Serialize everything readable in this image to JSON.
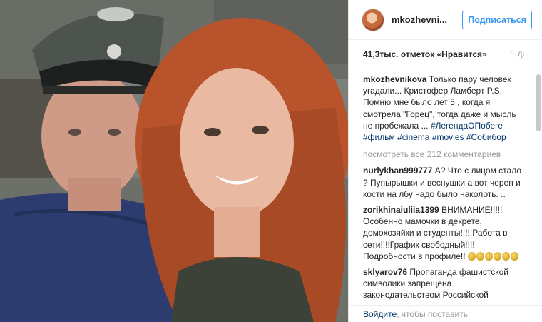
{
  "header": {
    "username": "mkozhevni...",
    "follow_label": "Подписаться"
  },
  "stats": {
    "likes": "41,3тыс. отметок «Нравится»",
    "time": "1 дн."
  },
  "caption": {
    "user": "mkozhevnikova",
    "text": "Только пару человек угадали... Кристофер Ламберт P.S. Помню мне было лет 5 , когда я смотрела \"Горец\", тогда даже и мысль не пробежала ...",
    "hashtags": [
      "#ЛегендаОПобеге",
      "#фильм",
      "#cinema",
      "#movies",
      "#Собибор"
    ]
  },
  "view_all": "посмотреть все 212 комментариев",
  "comments": [
    {
      "user": "nurlykhan999777",
      "text": "А? Что с лицом стало ? Пупырышки и веснушки а вот череп и кости на лбу надо было наколоть. .."
    },
    {
      "user": "zorikhinaiuliia1399",
      "text": "ВНИМАНИЕ!!!!! Особенно мамочки в декрете, домохозяйки и студенты!!!!!Работа в сети!!!!График свободный!!!! Подробности в профиле!!"
    },
    {
      "user": "sklyarov76",
      "text": "Пропаганда фашистской символики запрещена законодательством Российской"
    }
  ],
  "add_comment": {
    "link": "Войдите",
    "text": ", чтобы поставить"
  },
  "colors": {
    "link": "#003569",
    "follow": "#3897f0",
    "muted": "#999999"
  }
}
